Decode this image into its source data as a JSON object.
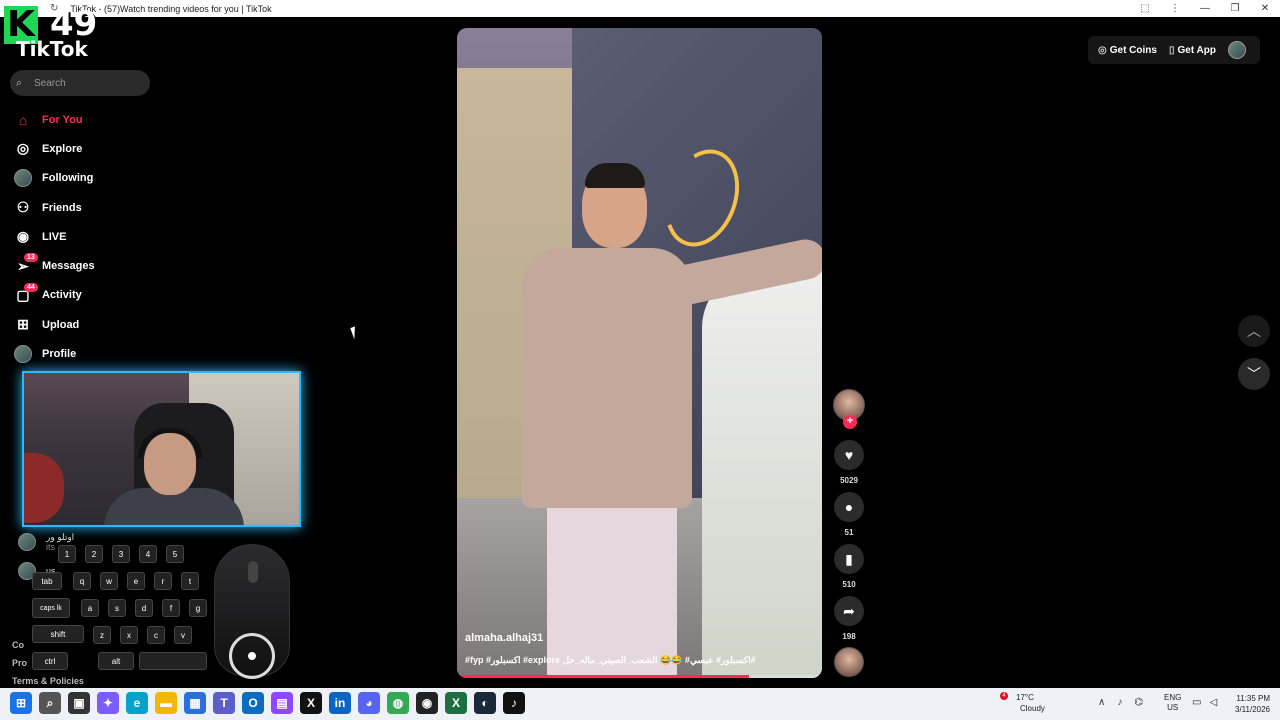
{
  "browser": {
    "tab_title": "TikTok - (57)Watch trending videos for you | TikTok",
    "nav_back": "←",
    "nav_reload": "↻",
    "extensions_icon": "⬚",
    "menu_icon": "⋮",
    "minimize": "—",
    "restore": "❐",
    "close": "✕"
  },
  "overlay": {
    "letter": "K",
    "number": "49"
  },
  "app": {
    "logo": "TikTok"
  },
  "search": {
    "placeholder": "Search"
  },
  "sidebar": {
    "items": [
      {
        "label": "For You",
        "icon": "home-icon",
        "glyph": "⌂"
      },
      {
        "label": "Explore",
        "icon": "compass-icon",
        "glyph": "◎"
      },
      {
        "label": "Following",
        "icon": "following-avatar",
        "glyph": ""
      },
      {
        "label": "Friends",
        "icon": "friends-icon",
        "glyph": "⚇"
      },
      {
        "label": "LIVE",
        "icon": "live-icon",
        "glyph": "◉"
      },
      {
        "label": "Messages",
        "icon": "send-icon",
        "glyph": "➢",
        "badge": "13"
      },
      {
        "label": "Activity",
        "icon": "activity-icon",
        "glyph": "▢",
        "badge": "44"
      },
      {
        "label": "Upload",
        "icon": "upload-icon",
        "glyph": "⊞"
      },
      {
        "label": "Profile",
        "icon": "profile-avatar",
        "glyph": ""
      }
    ],
    "accounts": [
      {
        "name": "اوتلو ور",
        "sub": "its"
      },
      {
        "name": "us",
        "sub": ""
      }
    ],
    "footer": [
      "Co",
      "Pro",
      "Terms & Policies"
    ]
  },
  "keyboard": {
    "row1": [
      "1",
      "2",
      "3",
      "4",
      "5"
    ],
    "row2": [
      "tab",
      "q",
      "w",
      "e",
      "r",
      "t"
    ],
    "row3": [
      "caps lk",
      "a",
      "s",
      "d",
      "f",
      "g"
    ],
    "row4": [
      "shift",
      "z",
      "x",
      "c",
      "v"
    ],
    "row5": [
      "ctrl",
      "alt",
      ""
    ]
  },
  "video": {
    "author": "almaha.alhaj31",
    "caption": "#fyp #اكسبلور #explore اكسبلور# عبسي# 😂😂 الشعب_الصيني_ماله_حل#",
    "progress": 0.8
  },
  "actions": {
    "likes": "5029",
    "comments": "51",
    "saves": "510",
    "shares": "198",
    "follow": "+"
  },
  "topbar": {
    "coins": "Get Coins",
    "app": "Get App"
  },
  "taskbar": {
    "icons": [
      {
        "name": "windows-start-icon",
        "glyph": "⊞",
        "color": "#1a73e8"
      },
      {
        "name": "search-icon",
        "glyph": "⌕",
        "color": "#555"
      },
      {
        "name": "taskview-icon",
        "glyph": "▣",
        "color": "#333"
      },
      {
        "name": "copilot-icon",
        "glyph": "✦",
        "color": "#7b5cff"
      },
      {
        "name": "edge-icon",
        "glyph": "e",
        "color": "#0aa1c8"
      },
      {
        "name": "file-explorer-icon",
        "glyph": "▬",
        "color": "#f2b705"
      },
      {
        "name": "store-icon",
        "glyph": "▦",
        "color": "#2b6fdb"
      },
      {
        "name": "teams-icon",
        "glyph": "T",
        "color": "#5b5fc7"
      },
      {
        "name": "outlook-icon",
        "glyph": "O",
        "color": "#0f6cbd"
      },
      {
        "name": "twitch-icon",
        "glyph": "▤",
        "color": "#9146ff"
      },
      {
        "name": "x-icon",
        "glyph": "X",
        "color": "#111"
      },
      {
        "name": "linkedin-icon",
        "glyph": "in",
        "color": "#0a66c2"
      },
      {
        "name": "discord-icon",
        "glyph": "◕",
        "color": "#5865f2"
      },
      {
        "name": "chrome-icon",
        "glyph": "◍",
        "color": "#34a853"
      },
      {
        "name": "obs-icon",
        "glyph": "◉",
        "color": "#222"
      },
      {
        "name": "excel-icon",
        "glyph": "X",
        "color": "#1d6f42"
      },
      {
        "name": "steam-icon",
        "glyph": "◐",
        "color": "#1b2838"
      },
      {
        "name": "tiktok-icon",
        "glyph": "♪",
        "color": "#111"
      }
    ],
    "weather_badge": "4",
    "temperature": "17°C",
    "condition": "Cloudy",
    "tray_chevron": "∧",
    "mic": "🎤",
    "lang_top": "ENG",
    "lang_bottom": "US",
    "time": "11:35 PM",
    "date": "3/11/2026"
  },
  "colors": {
    "accent": "#fe2c55",
    "webcam_border": "#2fb8ff",
    "overlay_green": "#1fd655"
  }
}
